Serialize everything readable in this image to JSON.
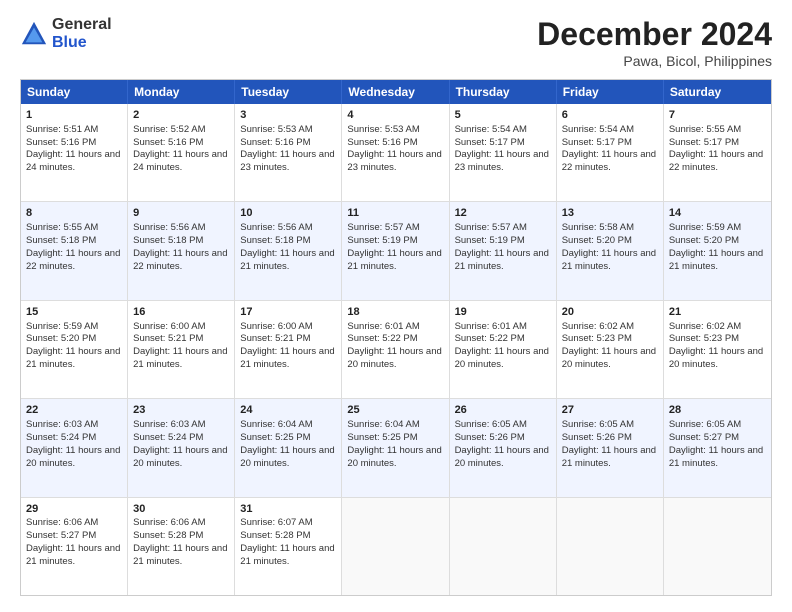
{
  "logo": {
    "general": "General",
    "blue": "Blue"
  },
  "title": "December 2024",
  "subtitle": "Pawa, Bicol, Philippines",
  "days": [
    "Sunday",
    "Monday",
    "Tuesday",
    "Wednesday",
    "Thursday",
    "Friday",
    "Saturday"
  ],
  "weeks": [
    [
      {
        "day": "1",
        "rise": "Sunrise: 5:51 AM",
        "set": "Sunset: 5:16 PM",
        "daylight": "Daylight: 11 hours and 24 minutes."
      },
      {
        "day": "2",
        "rise": "Sunrise: 5:52 AM",
        "set": "Sunset: 5:16 PM",
        "daylight": "Daylight: 11 hours and 24 minutes."
      },
      {
        "day": "3",
        "rise": "Sunrise: 5:53 AM",
        "set": "Sunset: 5:16 PM",
        "daylight": "Daylight: 11 hours and 23 minutes."
      },
      {
        "day": "4",
        "rise": "Sunrise: 5:53 AM",
        "set": "Sunset: 5:16 PM",
        "daylight": "Daylight: 11 hours and 23 minutes."
      },
      {
        "day": "5",
        "rise": "Sunrise: 5:54 AM",
        "set": "Sunset: 5:17 PM",
        "daylight": "Daylight: 11 hours and 23 minutes."
      },
      {
        "day": "6",
        "rise": "Sunrise: 5:54 AM",
        "set": "Sunset: 5:17 PM",
        "daylight": "Daylight: 11 hours and 22 minutes."
      },
      {
        "day": "7",
        "rise": "Sunrise: 5:55 AM",
        "set": "Sunset: 5:17 PM",
        "daylight": "Daylight: 11 hours and 22 minutes."
      }
    ],
    [
      {
        "day": "8",
        "rise": "Sunrise: 5:55 AM",
        "set": "Sunset: 5:18 PM",
        "daylight": "Daylight: 11 hours and 22 minutes."
      },
      {
        "day": "9",
        "rise": "Sunrise: 5:56 AM",
        "set": "Sunset: 5:18 PM",
        "daylight": "Daylight: 11 hours and 22 minutes."
      },
      {
        "day": "10",
        "rise": "Sunrise: 5:56 AM",
        "set": "Sunset: 5:18 PM",
        "daylight": "Daylight: 11 hours and 21 minutes."
      },
      {
        "day": "11",
        "rise": "Sunrise: 5:57 AM",
        "set": "Sunset: 5:19 PM",
        "daylight": "Daylight: 11 hours and 21 minutes."
      },
      {
        "day": "12",
        "rise": "Sunrise: 5:57 AM",
        "set": "Sunset: 5:19 PM",
        "daylight": "Daylight: 11 hours and 21 minutes."
      },
      {
        "day": "13",
        "rise": "Sunrise: 5:58 AM",
        "set": "Sunset: 5:20 PM",
        "daylight": "Daylight: 11 hours and 21 minutes."
      },
      {
        "day": "14",
        "rise": "Sunrise: 5:59 AM",
        "set": "Sunset: 5:20 PM",
        "daylight": "Daylight: 11 hours and 21 minutes."
      }
    ],
    [
      {
        "day": "15",
        "rise": "Sunrise: 5:59 AM",
        "set": "Sunset: 5:20 PM",
        "daylight": "Daylight: 11 hours and 21 minutes."
      },
      {
        "day": "16",
        "rise": "Sunrise: 6:00 AM",
        "set": "Sunset: 5:21 PM",
        "daylight": "Daylight: 11 hours and 21 minutes."
      },
      {
        "day": "17",
        "rise": "Sunrise: 6:00 AM",
        "set": "Sunset: 5:21 PM",
        "daylight": "Daylight: 11 hours and 21 minutes."
      },
      {
        "day": "18",
        "rise": "Sunrise: 6:01 AM",
        "set": "Sunset: 5:22 PM",
        "daylight": "Daylight: 11 hours and 20 minutes."
      },
      {
        "day": "19",
        "rise": "Sunrise: 6:01 AM",
        "set": "Sunset: 5:22 PM",
        "daylight": "Daylight: 11 hours and 20 minutes."
      },
      {
        "day": "20",
        "rise": "Sunrise: 6:02 AM",
        "set": "Sunset: 5:23 PM",
        "daylight": "Daylight: 11 hours and 20 minutes."
      },
      {
        "day": "21",
        "rise": "Sunrise: 6:02 AM",
        "set": "Sunset: 5:23 PM",
        "daylight": "Daylight: 11 hours and 20 minutes."
      }
    ],
    [
      {
        "day": "22",
        "rise": "Sunrise: 6:03 AM",
        "set": "Sunset: 5:24 PM",
        "daylight": "Daylight: 11 hours and 20 minutes."
      },
      {
        "day": "23",
        "rise": "Sunrise: 6:03 AM",
        "set": "Sunset: 5:24 PM",
        "daylight": "Daylight: 11 hours and 20 minutes."
      },
      {
        "day": "24",
        "rise": "Sunrise: 6:04 AM",
        "set": "Sunset: 5:25 PM",
        "daylight": "Daylight: 11 hours and 20 minutes."
      },
      {
        "day": "25",
        "rise": "Sunrise: 6:04 AM",
        "set": "Sunset: 5:25 PM",
        "daylight": "Daylight: 11 hours and 20 minutes."
      },
      {
        "day": "26",
        "rise": "Sunrise: 6:05 AM",
        "set": "Sunset: 5:26 PM",
        "daylight": "Daylight: 11 hours and 20 minutes."
      },
      {
        "day": "27",
        "rise": "Sunrise: 6:05 AM",
        "set": "Sunset: 5:26 PM",
        "daylight": "Daylight: 11 hours and 21 minutes."
      },
      {
        "day": "28",
        "rise": "Sunrise: 6:05 AM",
        "set": "Sunset: 5:27 PM",
        "daylight": "Daylight: 11 hours and 21 minutes."
      }
    ],
    [
      {
        "day": "29",
        "rise": "Sunrise: 6:06 AM",
        "set": "Sunset: 5:27 PM",
        "daylight": "Daylight: 11 hours and 21 minutes."
      },
      {
        "day": "30",
        "rise": "Sunrise: 6:06 AM",
        "set": "Sunset: 5:28 PM",
        "daylight": "Daylight: 11 hours and 21 minutes."
      },
      {
        "day": "31",
        "rise": "Sunrise: 6:07 AM",
        "set": "Sunset: 5:28 PM",
        "daylight": "Daylight: 11 hours and 21 minutes."
      },
      null,
      null,
      null,
      null
    ]
  ]
}
